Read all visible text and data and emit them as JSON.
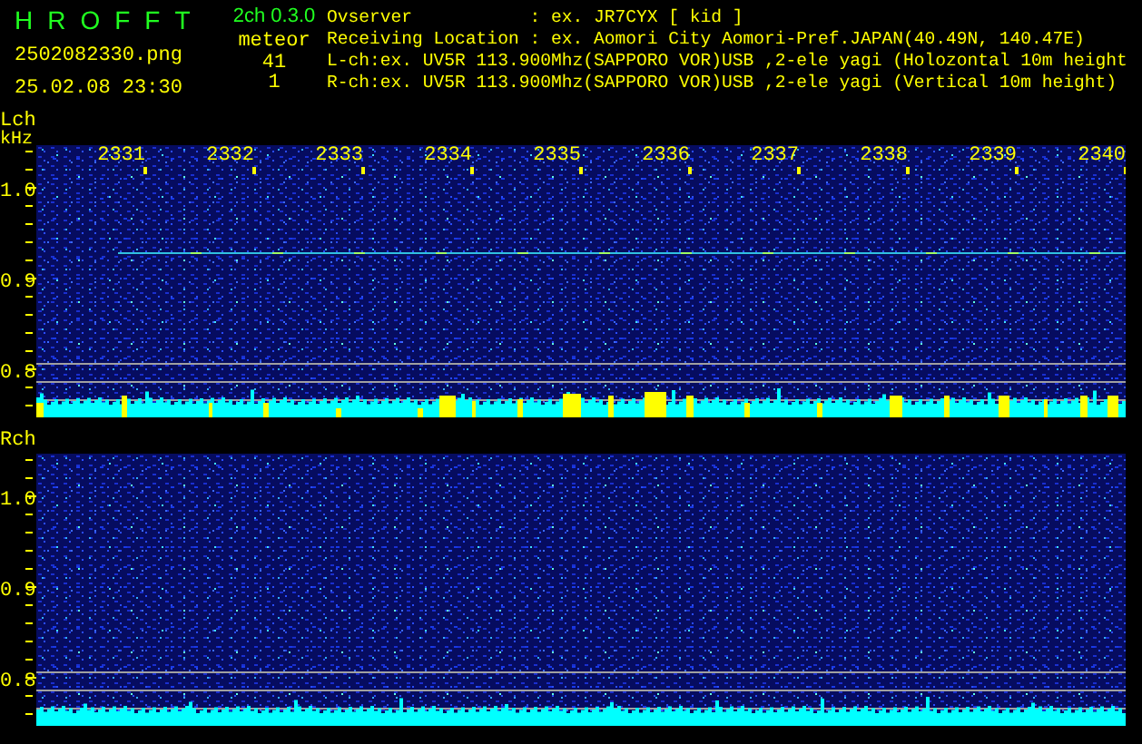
{
  "app": {
    "title": "HROFFT",
    "version": "2ch 0.3.0",
    "mode": "meteor",
    "filename": "2502082330.png",
    "timestamp": "25.02.08 23:30",
    "counts": [
      "41",
      "1"
    ]
  },
  "info": [
    "Ovserver           : ex. JR7CYX [ kid ]",
    "Receiving Location : ex. Aomori City Aomori-Pref.JAPAN(40.49N, 140.47E)",
    "L-ch:ex. UV5R 113.900Mhz(SAPPORO VOR)USB ,2-ele yagi (Holozontal 10m height",
    "R-ch:ex. UV5R 113.900Mhz(SAPPORO VOR)USB ,2-ele yagi (Vertical 10m height)"
  ],
  "panels": [
    {
      "channel": "Lch",
      "unit": "kHz",
      "kind": "meteor",
      "yticks": [
        "1.0",
        "0.9",
        "0.8"
      ],
      "time_labels": [
        "2331",
        "2332",
        "2333",
        "2334",
        "2335",
        "2336",
        "2337",
        "2338",
        "2339",
        "2340"
      ]
    },
    {
      "channel": "Rch",
      "kind": "quiet",
      "yticks": [
        "1.0",
        "0.9",
        "0.8"
      ]
    }
  ]
}
